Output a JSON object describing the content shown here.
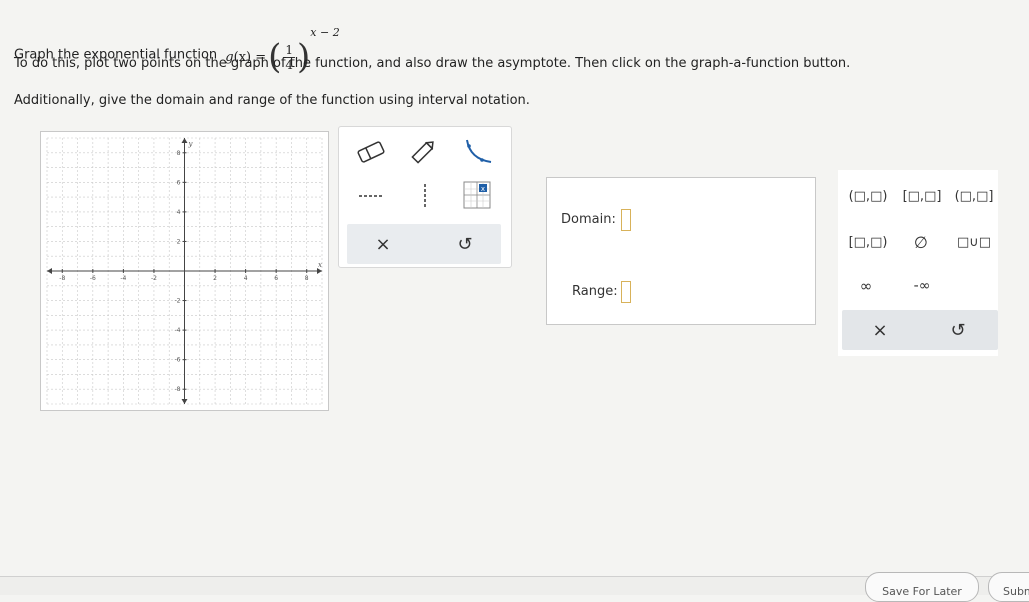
{
  "prompt": {
    "line1_prefix": "Graph the exponential function",
    "func_name": "g",
    "func_var": "(x) =",
    "frac_num": "1",
    "frac_den": "4",
    "exponent": "x − 2",
    "line1_suffix": ".",
    "line2": "To do this, plot two points on the graph of the function, and also draw the asymptote. Then click on the graph-a-function button.",
    "line3": "Additionally, give the domain and range of the function using interval notation."
  },
  "graph": {
    "x_range": [
      -9,
      9
    ],
    "y_range": [
      -9,
      9
    ],
    "x_ticks": [
      "-8",
      "-6",
      "-4",
      "-2",
      "2",
      "4",
      "6",
      "8"
    ],
    "y_ticks": [
      "8",
      "6",
      "4",
      "2",
      "-2",
      "-4",
      "-6",
      "-8"
    ],
    "x_axis_label": "x",
    "y_axis_label": "y",
    "grid": true
  },
  "tools": {
    "eraser_icon": "eraser-icon",
    "pencil_icon": "pencil-icon",
    "curve_icon": "exponential-curve-icon",
    "h_asymptote_icon": "horizontal-dashed-line-icon",
    "v_asymptote_icon": "vertical-dashed-line-icon",
    "graph_function_icon": "graph-function-icon",
    "clear_label": "×",
    "undo_label": "↺"
  },
  "answer": {
    "domain_label": "Domain:",
    "range_label": "Range:",
    "domain_value": "",
    "range_value": ""
  },
  "interval_keys": {
    "open_open": "(□,□)",
    "closed_closed": "[□,□]",
    "open_closed": "(□,□]",
    "closed_open": "[□,□)",
    "empty_set": "∅",
    "union": "□∪□",
    "infinity": "∞",
    "neg_infinity": "-∞",
    "clear_label": "×",
    "undo_label": "↺"
  },
  "bottom": {
    "save_later_label": "Save For Later",
    "submit_label": "Submit"
  },
  "colors": {
    "accent_blue": "#1f5fa8",
    "input_border": "#d8b25a",
    "grid_line": "#c8c8c8"
  }
}
